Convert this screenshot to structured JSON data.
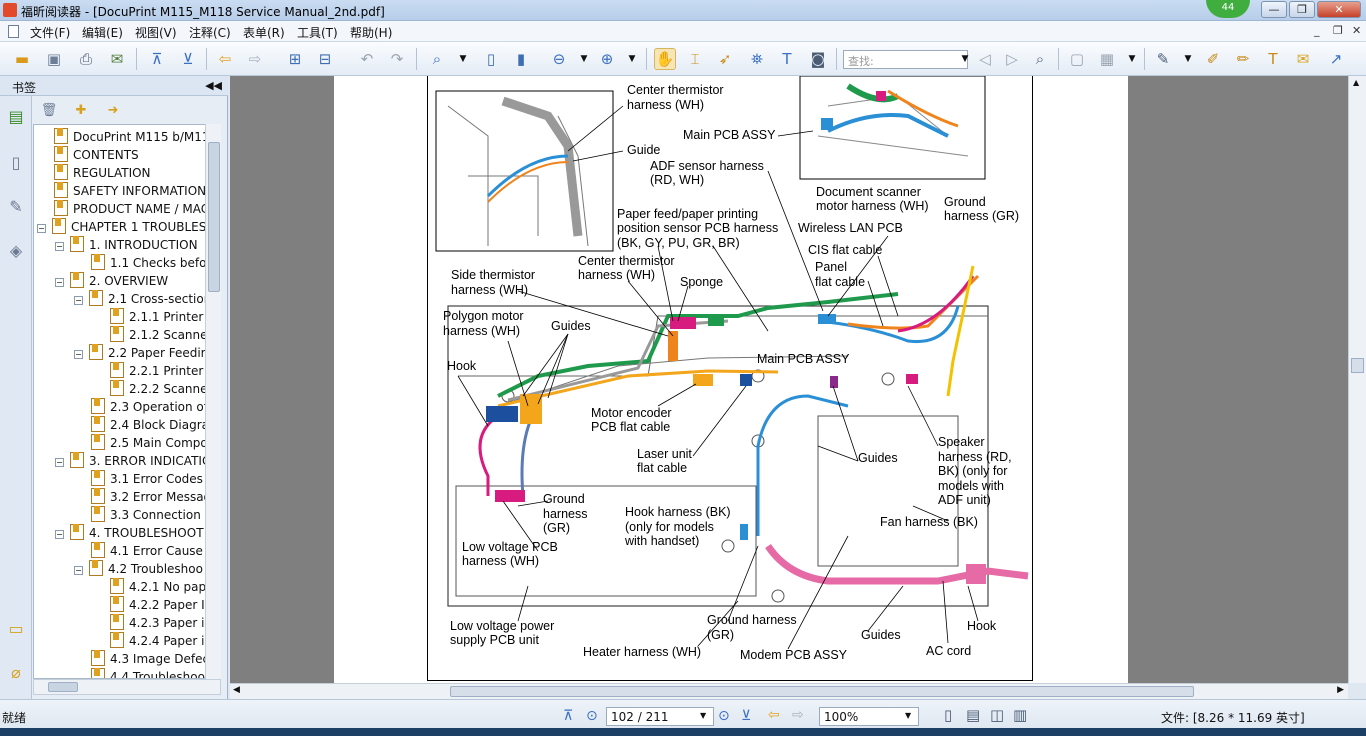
{
  "window": {
    "title": "福昕阅读器 - [DocuPrint M115_M118 Service Manual_2nd.pdf]",
    "notification_count": "44",
    "controls": {
      "minimize": "—",
      "maximize": "❐",
      "close": "✕"
    }
  },
  "menu": {
    "items": [
      "文件(F)",
      "编辑(E)",
      "视图(V)",
      "注释(C)",
      "表单(R)",
      "工具(T)",
      "帮助(H)"
    ],
    "mdi_controls": [
      "_",
      "❐",
      "✕"
    ]
  },
  "toolbar": {
    "find_placeholder": "查找:"
  },
  "sidebar": {
    "title": "书签",
    "tree": [
      {
        "label": "DocuPrint M115 b/M115",
        "level": 0,
        "expander": ""
      },
      {
        "label": "CONTENTS",
        "level": 0,
        "expander": ""
      },
      {
        "label": "REGULATION",
        "level": 0,
        "expander": ""
      },
      {
        "label": "SAFETY INFORMATION",
        "level": 0,
        "expander": ""
      },
      {
        "label": "PRODUCT NAME / MAC",
        "level": 0,
        "expander": ""
      },
      {
        "label": "CHAPTER 1 TROUBLESI",
        "level": 0,
        "expander": "−"
      },
      {
        "label": "1. INTRODUCTION",
        "level": 1,
        "expander": "−"
      },
      {
        "label": "1.1 Checks befo",
        "level": 2,
        "expander": ""
      },
      {
        "label": "2. OVERVIEW",
        "level": 1,
        "expander": "−"
      },
      {
        "label": "2.1 Cross-section",
        "level": 2,
        "expander": "−"
      },
      {
        "label": "2.1.1 Printer",
        "level": 3,
        "expander": ""
      },
      {
        "label": "2.1.2 Scanne",
        "level": 3,
        "expander": ""
      },
      {
        "label": "2.2 Paper Feedir",
        "level": 2,
        "expander": "−"
      },
      {
        "label": "2.2.1 Printer",
        "level": 3,
        "expander": ""
      },
      {
        "label": "2.2.2 Scanne",
        "level": 3,
        "expander": ""
      },
      {
        "label": "2.3 Operation of",
        "level": 2,
        "expander": ""
      },
      {
        "label": "2.4 Block Diagrai",
        "level": 2,
        "expander": ""
      },
      {
        "label": "2.5 Main Compor",
        "level": 2,
        "expander": ""
      },
      {
        "label": "3. ERROR INDICATIC",
        "level": 1,
        "expander": "−"
      },
      {
        "label": "3.1 Error Codes",
        "level": 2,
        "expander": ""
      },
      {
        "label": "3.2 Error Messag",
        "level": 2,
        "expander": ""
      },
      {
        "label": "3.3 Connection I",
        "level": 2,
        "expander": ""
      },
      {
        "label": "4. TROUBLESHOOT",
        "level": 1,
        "expander": "−"
      },
      {
        "label": "4.1 Error Cause a",
        "level": 2,
        "expander": ""
      },
      {
        "label": "4.2 Troubleshoo",
        "level": 2,
        "expander": "−"
      },
      {
        "label": "4.2.1 No pap",
        "level": 3,
        "expander": ""
      },
      {
        "label": "4.2.2 Paper I",
        "level": 3,
        "expander": ""
      },
      {
        "label": "4.2.3 Paper i",
        "level": 3,
        "expander": ""
      },
      {
        "label": "4.2.4 Paper i",
        "level": 3,
        "expander": ""
      },
      {
        "label": "4.3 Image Defec",
        "level": 2,
        "expander": ""
      },
      {
        "label": "4.4 Troubleshoo",
        "level": 2,
        "expander": ""
      }
    ]
  },
  "diagram": {
    "labels": {
      "center_thermistor_top_1": "Center thermistor",
      "center_thermistor_top_2": "harness (WH)",
      "guide": "Guide",
      "main_pcb_top": "Main PCB ASSY",
      "adf_sensor_1": "ADF sensor harness",
      "adf_sensor_2": "(RD, WH)",
      "doc_scanner_1": "Document scanner",
      "doc_scanner_2": "motor harness (WH)",
      "ground_gr_top_1": "Ground",
      "ground_gr_top_2": "harness (GR)",
      "paper_feed_1": "Paper feed/paper printing",
      "paper_feed_2": "position sensor PCB harness",
      "paper_feed_3": "(BK, GY, PU, GR, BR)",
      "wireless_lan": "Wireless LAN PCB",
      "cis_flat": "CIS flat cable",
      "side_thermistor_1": "Side thermistor",
      "side_thermistor_2": "harness (WH)",
      "center_thermistor_mid_1": "Center thermistor",
      "center_thermistor_mid_2": "harness (WH)",
      "panel_flat_1": "Panel",
      "panel_flat_2": "flat cable",
      "sponge": "Sponge",
      "polygon_1": "Polygon motor",
      "polygon_2": "harness (WH)",
      "guides_left": "Guides",
      "main_pcb_mid": "Main PCB ASSY",
      "hook_left": "Hook",
      "motor_encoder_1": "Motor encoder",
      "motor_encoder_2": "PCB flat cable",
      "laser_1": "Laser unit",
      "laser_2": "flat cable",
      "guides_right": "Guides",
      "speaker_1": "Speaker",
      "speaker_2": "harness (RD,",
      "speaker_3": "BK) (only for",
      "speaker_4": "models with",
      "speaker_5": "ADF unit)",
      "ground_mid_1": "Ground",
      "ground_mid_2": "harness",
      "ground_mid_3": "(GR)",
      "hook_harness_1": "Hook harness (BK)",
      "hook_harness_2": "(only for models",
      "hook_harness_3": "with handset)",
      "fan_harness": "Fan harness (BK)",
      "lv_pcb_harness_1": "Low voltage PCB",
      "lv_pcb_harness_2": "harness (WH)",
      "lv_power_1": "Low voltage power",
      "lv_power_2": "supply PCB unit",
      "ground_bottom_1": "Ground harness",
      "ground_bottom_2": "(GR)",
      "guides_bottom": "Guides",
      "hook_bottom": "Hook",
      "heater": "Heater harness (WH)",
      "modem": "Modem PCB ASSY",
      "ac_cord": "AC cord"
    }
  },
  "status": {
    "left": "就绪",
    "page_display": "102 / 211",
    "zoom": "100%",
    "file_size": "文件: [8.26 * 11.69 英寸]"
  },
  "colors": {
    "harness_green": "#1f9a4c",
    "harness_blue": "#2b8fd6",
    "harness_orange": "#f0841c",
    "harness_magenta": "#d81b7e",
    "harness_yellow": "#f2c200",
    "connector_gold": "#f3a51c",
    "connector_navy": "#1d4f9f"
  }
}
